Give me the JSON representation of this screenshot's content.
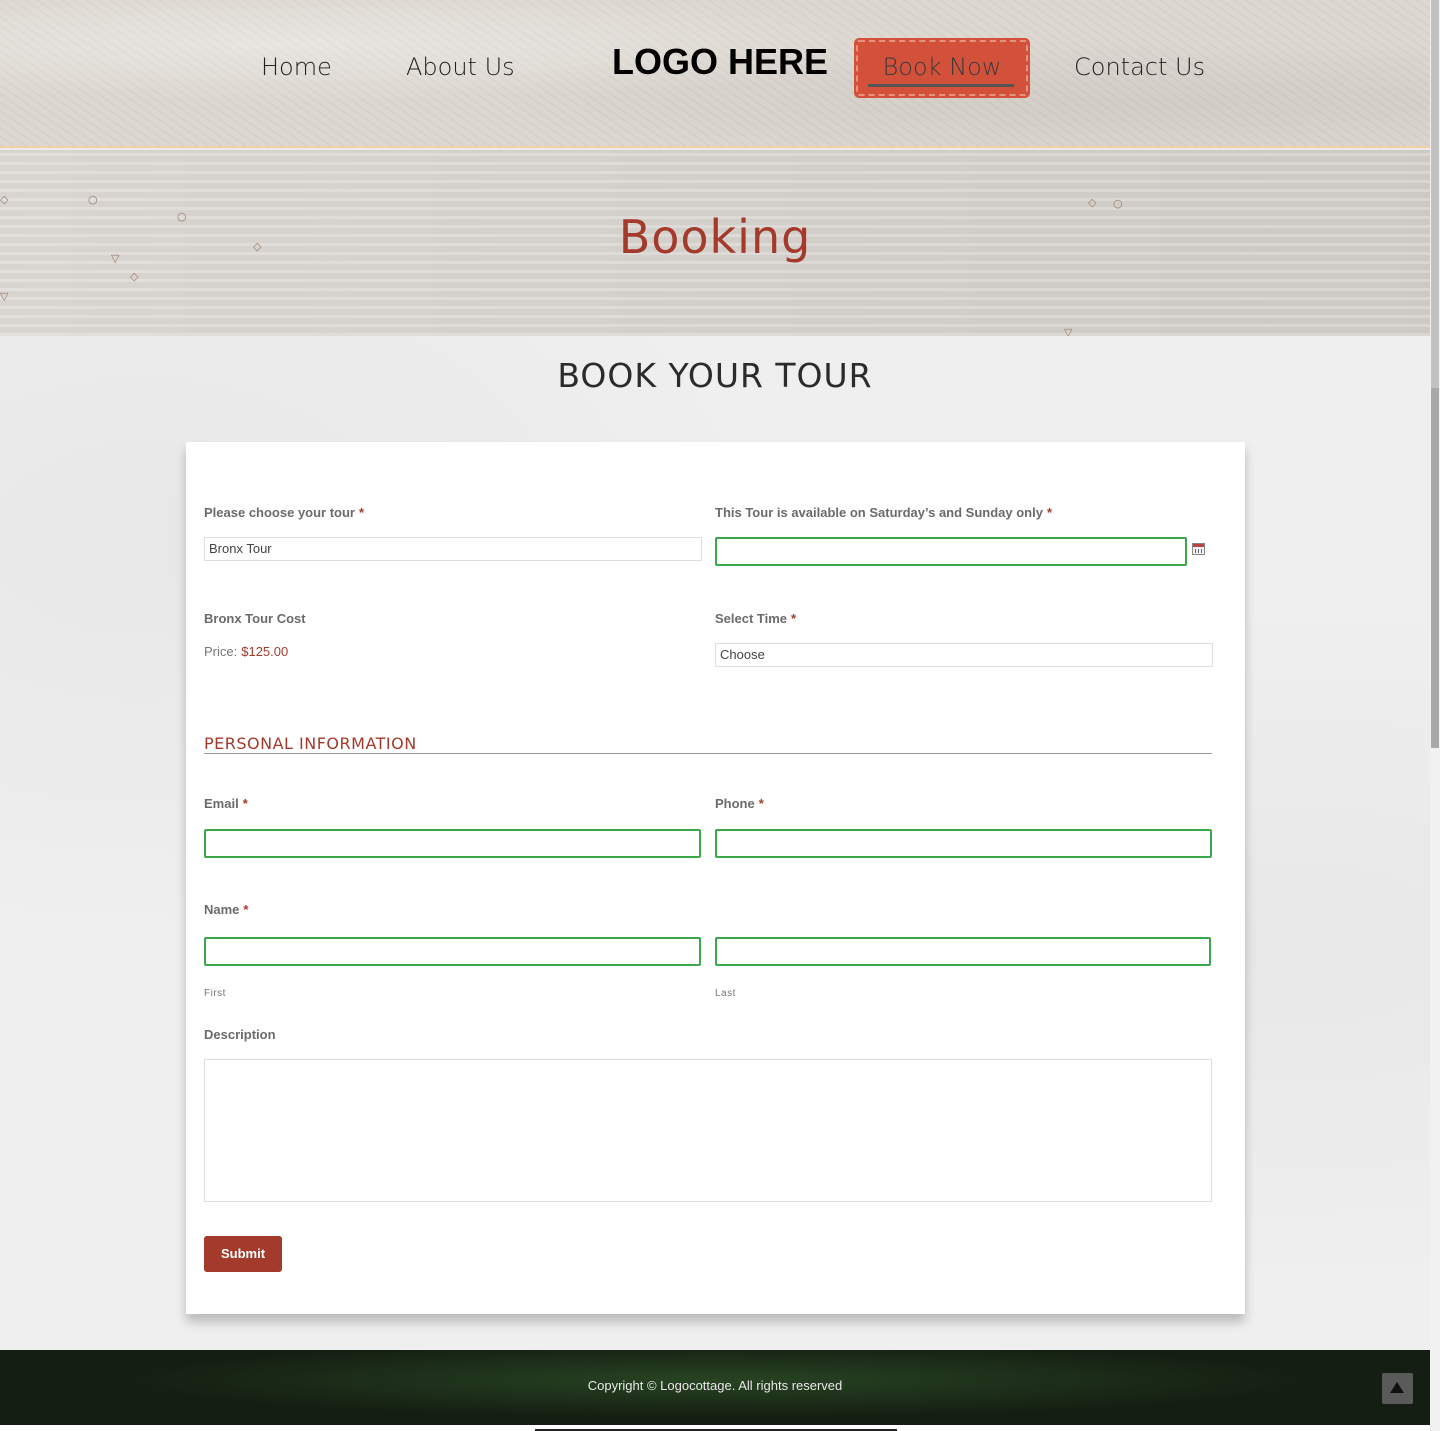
{
  "nav": {
    "home": "Home",
    "about": "About Us",
    "logo": "LOGO HERE",
    "book_now": "Book Now",
    "contact": "Contact Us"
  },
  "banner": {
    "title": "Booking"
  },
  "main": {
    "section_title": "BOOK YOUR TOUR"
  },
  "form": {
    "tour_label": "Please choose your tour",
    "tour_value": "Bronx Tour",
    "date_label": "This Tour is available on Saturday’s and Sunday only",
    "cost_label": "Bronx Tour Cost",
    "price_label": "Price:",
    "price_value": "$125.00",
    "time_label": "Select Time",
    "time_value": "Choose",
    "personal_heading": "PERSONAL INFORMATION",
    "email_label": "Email",
    "phone_label": "Phone",
    "name_label": "Name",
    "first_sublabel": "First",
    "last_sublabel": "Last",
    "description_label": "Description",
    "submit_label": "Submit",
    "required_mark": "*"
  },
  "footer": {
    "copyright": "Copyright © Logocottage. All rights reserved"
  },
  "colors": {
    "accent": "#a33a2b",
    "book_now_bg": "#d3503b",
    "focus_border": "#3aa84a",
    "footer_bg": "#1f2a1d"
  },
  "icons": {
    "calendar": "calendar-icon",
    "scroll_top": "chevron-up-icon"
  }
}
